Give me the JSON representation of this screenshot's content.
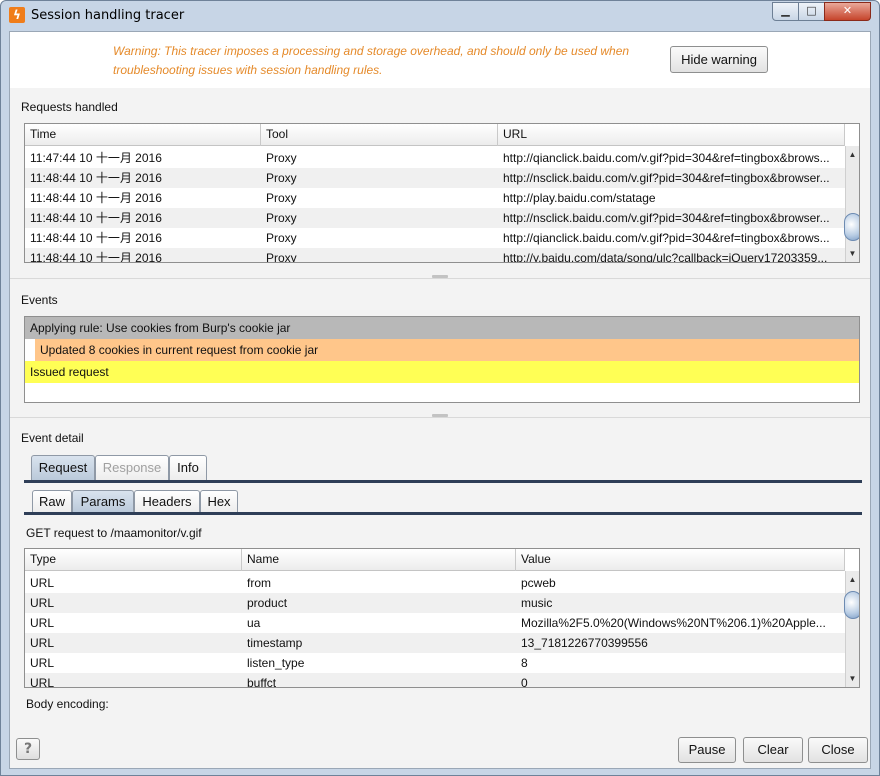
{
  "window": {
    "title": "Session handling tracer",
    "minimize_glyph": "▁",
    "maximize_glyph": "□",
    "close_glyph": "✕",
    "app_icon": "lightning-icon"
  },
  "warning": {
    "text": "Warning: This tracer imposes a processing and storage overhead, and should only be used when troubleshooting issues with session handling rules.",
    "color": "#e58a2a",
    "hide_label": "Hide warning"
  },
  "requests": {
    "label": "Requests handled",
    "columns": [
      "Time",
      "Tool",
      "URL"
    ],
    "rows": [
      {
        "time": "11:47:44 10 十一月 2016",
        "tool": "Proxy",
        "url": "http://qianclick.baidu.com/v.gif?pid=304&ref=tingbox&brows..."
      },
      {
        "time": "11:48:44 10 十一月 2016",
        "tool": "Proxy",
        "url": "http://nsclick.baidu.com/v.gif?pid=304&ref=tingbox&browser..."
      },
      {
        "time": "11:48:44 10 十一月 2016",
        "tool": "Proxy",
        "url": "http://play.baidu.com/statage"
      },
      {
        "time": "11:48:44 10 十一月 2016",
        "tool": "Proxy",
        "url": "http://nsclick.baidu.com/v.gif?pid=304&ref=tingbox&browser..."
      },
      {
        "time": "11:48:44 10 十一月 2016",
        "tool": "Proxy",
        "url": "http://qianclick.baidu.com/v.gif?pid=304&ref=tingbox&brows..."
      },
      {
        "time": "11:48:44 10 十一月 2016",
        "tool": "Proxy",
        "url": "http://y.baidu.com/data/song/ulc?callback=jQuery17203359..."
      }
    ]
  },
  "events": {
    "label": "Events",
    "items": [
      {
        "text": "Applying rule: Use cookies from Burp's cookie jar",
        "color": "#b8b8b8"
      },
      {
        "text": "Updated 8 cookies in current request from cookie jar",
        "color": "#ffc68a"
      },
      {
        "text": "Issued request",
        "color": "#ffff55"
      }
    ]
  },
  "detail": {
    "label": "Event detail",
    "tabs": [
      "Request",
      "Response",
      "Info"
    ],
    "subtabs": [
      "Raw",
      "Params",
      "Headers",
      "Hex"
    ],
    "request_line": "GET request to /maamonitor/v.gif",
    "params_columns": [
      "Type",
      "Name",
      "Value"
    ],
    "params": [
      {
        "type": "URL",
        "name": "from",
        "value": "pcweb"
      },
      {
        "type": "URL",
        "name": "product",
        "value": "music"
      },
      {
        "type": "URL",
        "name": "ua",
        "value": "Mozilla%2F5.0%20(Windows%20NT%206.1)%20Apple..."
      },
      {
        "type": "URL",
        "name": "timestamp",
        "value": "13_7181226770399556"
      },
      {
        "type": "URL",
        "name": "listen_type",
        "value": "8"
      },
      {
        "type": "URL",
        "name": "buffct",
        "value": "0"
      }
    ],
    "body_encoding_label": "Body encoding:"
  },
  "footer": {
    "help_label": "?",
    "pause_label": "Pause",
    "clear_label": "Clear",
    "close_label": "Close"
  }
}
